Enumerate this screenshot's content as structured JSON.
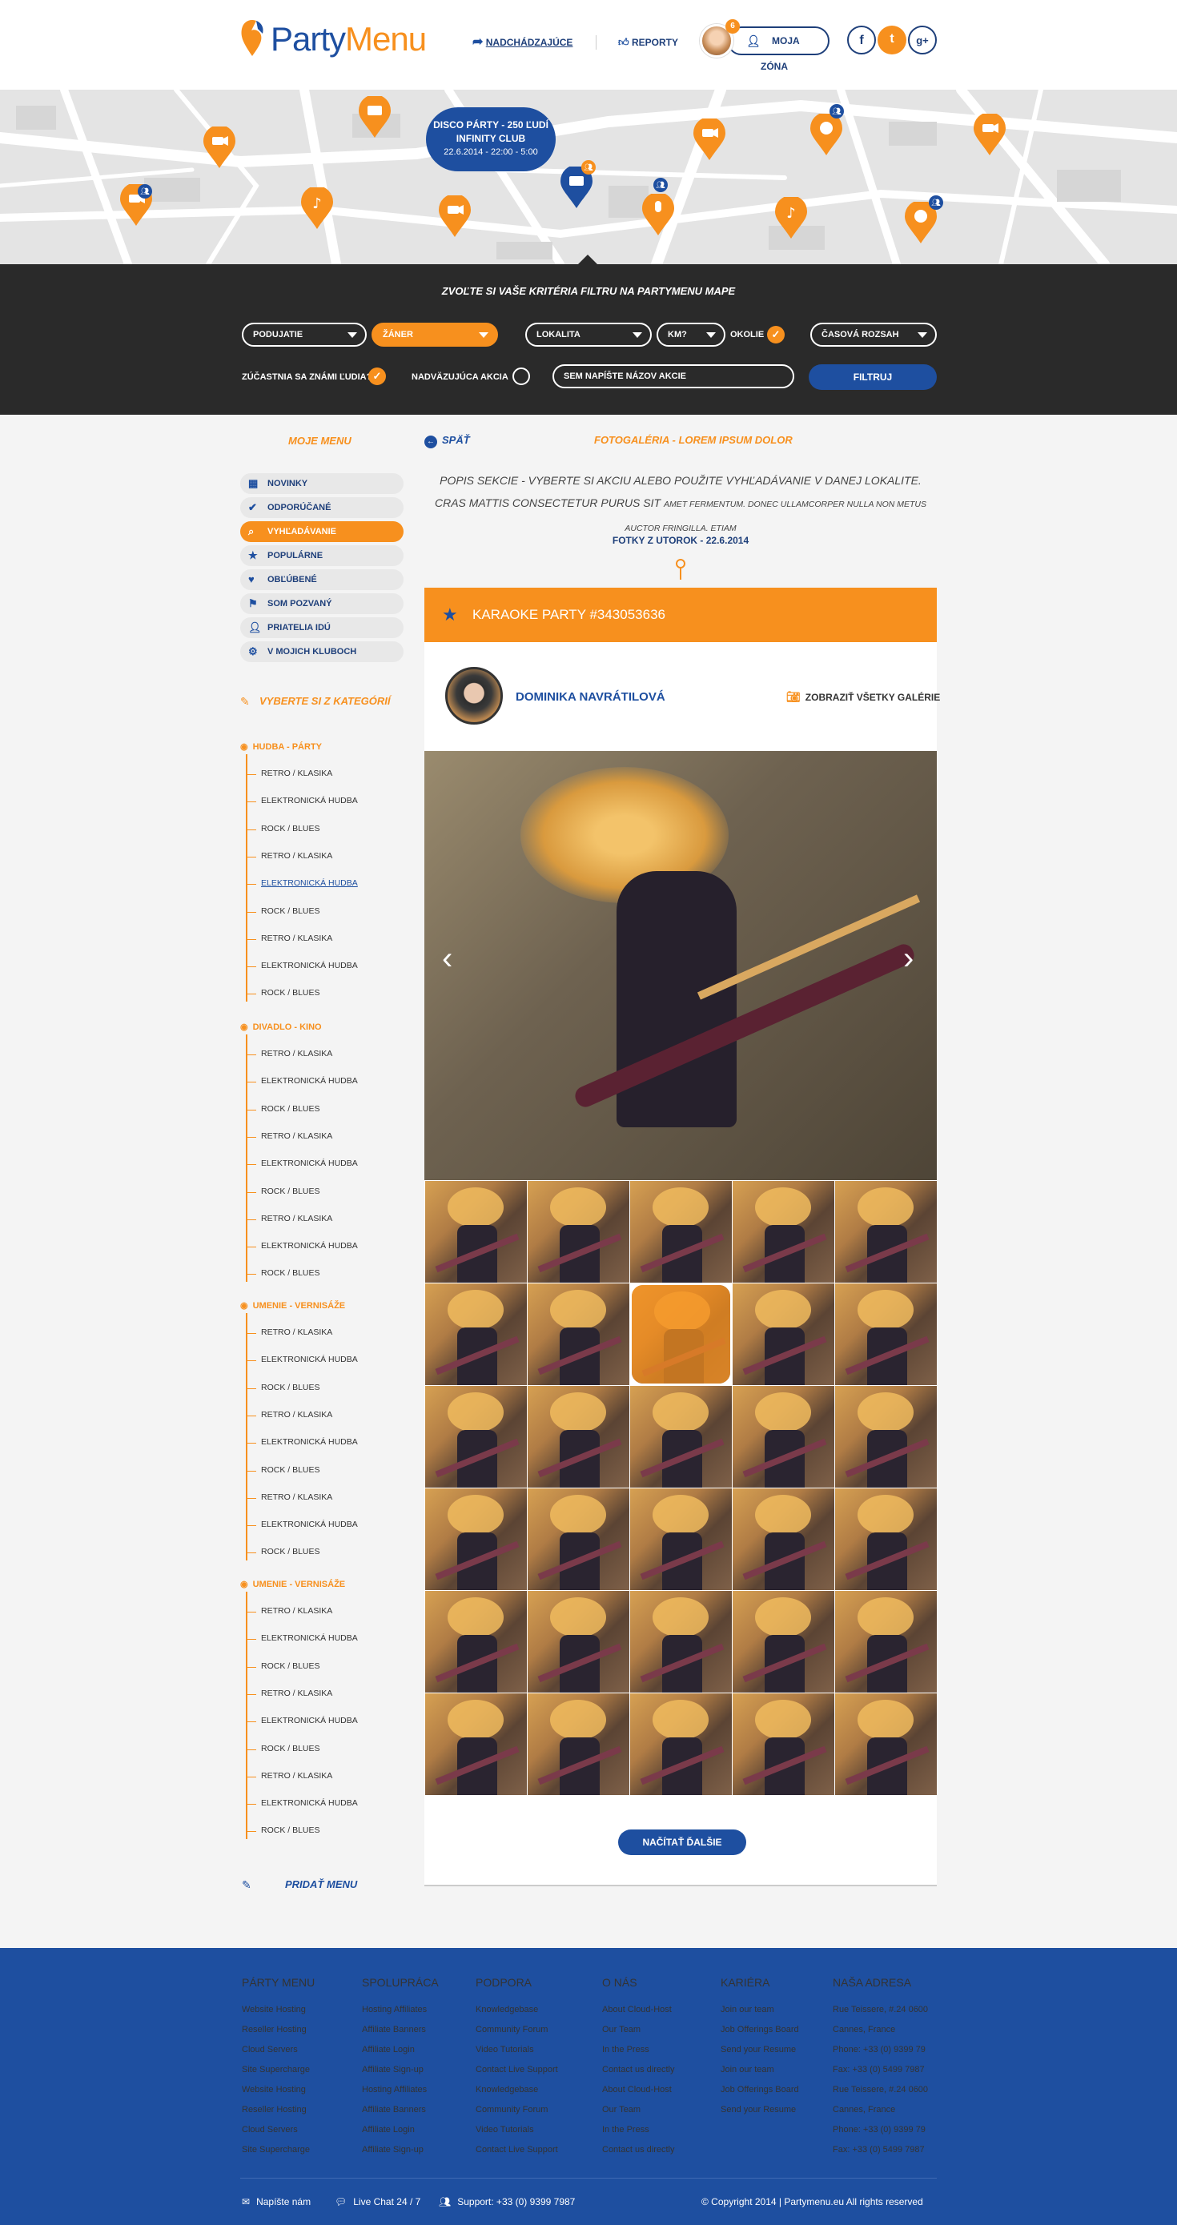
{
  "brand": {
    "logo_part1": "Party",
    "logo_part2": "Menu"
  },
  "header": {
    "nav_upcoming": "NADCHÁDZAJÚCE",
    "nav_reports": "REPORTY",
    "notif_count": "6",
    "zone_label": "MOJA ZÓNA",
    "social": [
      "f",
      "t",
      "g+"
    ]
  },
  "map": {
    "popup_title": "DISCO PÁRTY - 250 ĽUDÍ",
    "popup_club": "INFINITY CLUB",
    "popup_date": "22.6.2014 - 22:00 - 5:00"
  },
  "filter": {
    "title": "ZVOĽTE SI VAŠE KRITÉRIA FILTRU NA PARTYMENU MAPE",
    "sel_podujatie": "PODUJATIE",
    "sel_zaner": "ŽÁNER",
    "sel_lokalita": "LOKALITA",
    "sel_km": "KM?",
    "okolie": "OKOLIE",
    "casovy": "ČASOVÁ ROZSAH",
    "known": "ZÚČASTNIA SA ZNÁMI ĽUDIA?",
    "follow": "NADVÄZUJÚCA AKCIA",
    "search_placeholder": "SEM NAPÍŠTE NÁZOV AKCIE",
    "button": "FILTRUJ"
  },
  "sidebar": {
    "title": "MOJE MENU",
    "items": [
      "NOVINKY",
      "ODPORÚČANÉ",
      "VYHĽADÁVANIE",
      "POPULÁRNE",
      "OBĽÚBENÉ",
      "SOM POZVANÝ",
      "PRIATELIA IDÚ",
      "V MOJICH KLUBOCH"
    ],
    "choose_cat": "VYBERTE SI Z KATEGÓRIÍ",
    "categories": [
      {
        "name": "HUDBA - PÁRTY",
        "subs": [
          "RETRO / KLASIKA",
          "ELEKTRONICKÁ HUDBA",
          "ROCK / BLUES",
          "RETRO / KLASIKA",
          "ELEKTRONICKÁ HUDBA",
          "ROCK / BLUES",
          "RETRO / KLASIKA",
          "ELEKTRONICKÁ HUDBA",
          "ROCK / BLUES"
        ]
      },
      {
        "name": "DIVADLO - KINO",
        "subs": [
          "RETRO / KLASIKA",
          "ELEKTRONICKÁ HUDBA",
          "ROCK / BLUES",
          "RETRO / KLASIKA",
          "ELEKTRONICKÁ HUDBA",
          "ROCK / BLUES",
          "RETRO / KLASIKA",
          "ELEKTRONICKÁ HUDBA",
          "ROCK / BLUES"
        ]
      },
      {
        "name": "UMENIE - VERNISÁŽE",
        "subs": [
          "RETRO / KLASIKA",
          "ELEKTRONICKÁ HUDBA",
          "ROCK / BLUES",
          "RETRO / KLASIKA",
          "ELEKTRONICKÁ HUDBA",
          "ROCK / BLUES",
          "RETRO / KLASIKA",
          "ELEKTRONICKÁ HUDBA",
          "ROCK / BLUES"
        ]
      },
      {
        "name": "UMENIE - VERNISÁŽE",
        "subs": [
          "RETRO / KLASIKA",
          "ELEKTRONICKÁ HUDBA",
          "ROCK / BLUES",
          "RETRO / KLASIKA",
          "ELEKTRONICKÁ HUDBA",
          "ROCK / BLUES",
          "RETRO / KLASIKA",
          "ELEKTRONICKÁ HUDBA",
          "ROCK / BLUES"
        ]
      }
    ],
    "add_menu": "PRIDAŤ MENU"
  },
  "content": {
    "back": "SPÄŤ",
    "gallery_title": "FOTOGALÉRIA - LOREM IPSUM DOLOR",
    "intro_big": "POPIS SEKCIE - VYBERTE SI AKCIU ALEBO POUŽITE VYHĽADÁVANIE V DANEJ LOKALITE. CRAS MATTIS CONSECTETUR PURUS SIT",
    "intro_small": "AMET FERMENTUM. DONEC ULLAMCORPER NULLA NON METUS AUCTOR FRINGILLA. ETIAM",
    "date": "FOTKY Z UTOROK - 22.6.2014",
    "event_title": "KARAOKE PARTY #343053636",
    "user_name": "DOMINIKA NAVRÁTILOVÁ",
    "all_galleries": "ZOBRAZIŤ VŠETKY GALÉRIE",
    "load_more": "NAČÍTAŤ ĎALŠIE"
  },
  "footer": {
    "cols": [
      {
        "title": "PÁRTY MENU",
        "links": [
          "Website Hosting",
          "Reseller Hosting",
          "Cloud Servers",
          "Site Supercharge",
          "Website Hosting",
          "Reseller Hosting",
          "Cloud Servers",
          "Site Supercharge"
        ]
      },
      {
        "title": "SPOLUPRÁCA",
        "links": [
          "Hosting Affiliates",
          "Affiliate Banners",
          "Affiliate Login",
          "Affiliate Sign-up",
          "Hosting Affiliates",
          "Affiliate Banners",
          "Affiliate Login",
          "Affiliate Sign-up"
        ]
      },
      {
        "title": "PODPORA",
        "links": [
          "Knowledgebase",
          "Community Forum",
          "Video Tutorials",
          "Contact Live Support",
          "Knowledgebase",
          "Community Forum",
          "Video Tutorials",
          "Contact Live Support"
        ]
      },
      {
        "title": "O NÁS",
        "links": [
          "About Cloud-Host",
          "Our Team",
          "In the Press",
          "Contact us directly",
          "About Cloud-Host",
          "Our Team",
          "In the Press",
          "Contact us directly"
        ]
      },
      {
        "title": "KARIÉRA",
        "links": [
          "Join our team",
          "Job Offerings Board",
          "Send your Resume",
          "Join our team",
          "Job Offerings Board",
          "Send your Resume"
        ]
      },
      {
        "title": "NAŠA ADRESA",
        "links": [
          "Rue Teissere, #.24 0600",
          "Cannes, France",
          "Phone: +33 (0) 9399 79",
          "Fax: +33 (0) 5499 7987",
          "Rue Teissere, #.24 0600",
          "Cannes, France",
          "Phone: +33 (0) 9399 79",
          "Fax: +33 (0) 5499 7987"
        ]
      }
    ],
    "write_us": "Napíšte nám",
    "live_chat": "Live Chat 24 / 7",
    "support": "Support: +33 (0) 9399 7987",
    "copyright": "© Copyright 2014  |  Partymenu.eu All rights reserved"
  },
  "colors": {
    "orange": "#f7901e",
    "blue": "#1e4fa0",
    "dark": "#2a2a2a"
  }
}
